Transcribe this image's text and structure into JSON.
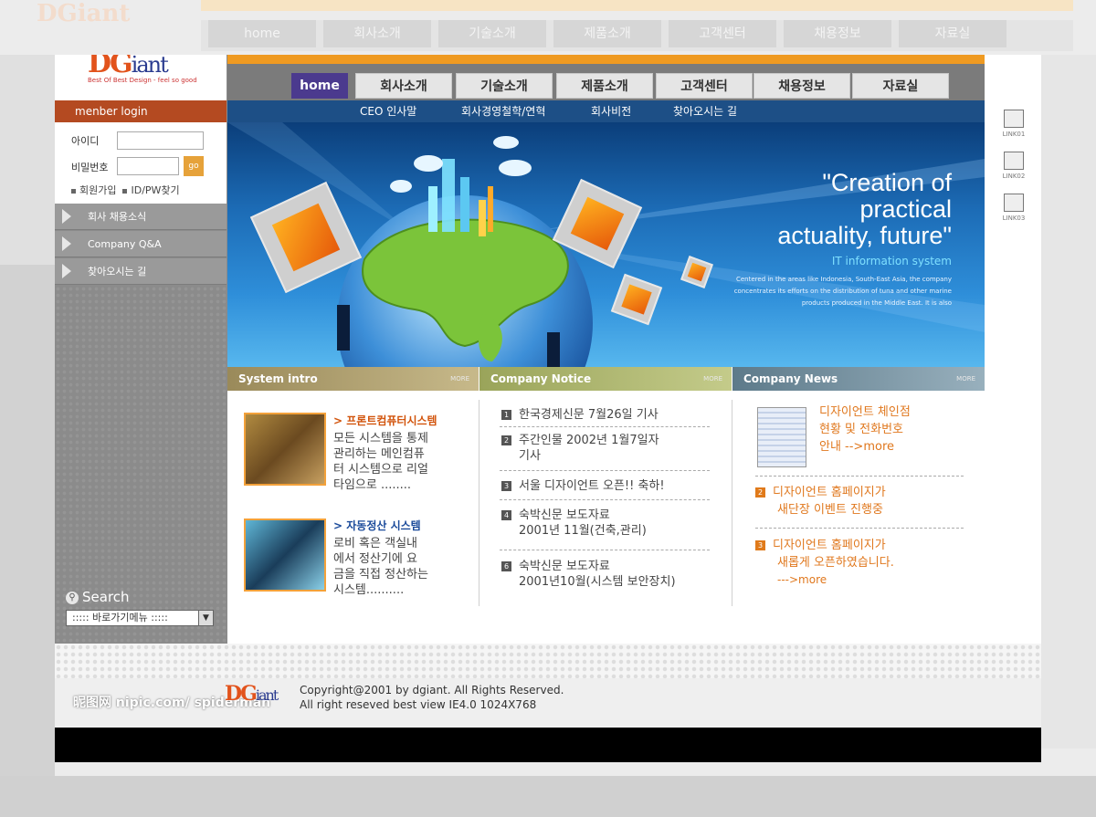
{
  "brand": {
    "logo": "DGiant",
    "tagline": "Best Of Best Design - feel so good"
  },
  "login": {
    "header": "menber login",
    "id_label": "아이디",
    "pw_label": "비밀번호",
    "go_label": "go",
    "join_link": "회원가입",
    "find_link": "ID/PW찾기"
  },
  "side_menu": [
    "회사 채용소식",
    "Company Q&A",
    "찾아오시는 길"
  ],
  "search": {
    "label": "Search",
    "select_value": "::::: 바로가기메뉴 :::::"
  },
  "nav": {
    "home": "home",
    "tabs": [
      "회사소개",
      "기술소개",
      "제품소개",
      "고객센터",
      "채용정보",
      "자료실"
    ]
  },
  "sub_nav": [
    "CEO 인사말",
    "회사경영철학/연혁",
    "회사비전",
    "찾아오시는 길"
  ],
  "hero": {
    "title_line1": "\"Creation of",
    "title_line2": "practical",
    "title_line3": "actuality, future\"",
    "subtitle": "IT information system",
    "desc": "Centered in the areas like Indonesia, South-East Asia, the company concentrates its efforts on the distribution of tuna and other marine products produced in the Middle East. It is also"
  },
  "panels": {
    "system_intro": {
      "title": "System intro",
      "more": "MORE",
      "items": [
        {
          "title": "프론트컴퓨터시스템",
          "text_1": "모든 시스템을 통제",
          "text_2": "관리하는 메인컴퓨",
          "text_3": "터 시스템으로 리얼",
          "text_4": "타임으로 ........"
        },
        {
          "title": "자동정산 시스템",
          "text_1": "로비 혹은 객실내",
          "text_2": "에서 정산기에 요",
          "text_3": "금을 직접 정산하는",
          "text_4": "시스템.........."
        }
      ]
    },
    "company_notice": {
      "title": "Company Notice",
      "more": "MORE",
      "items": [
        {
          "n": "1",
          "line1": "한국경제신문 7월26일 기사",
          "line2": ""
        },
        {
          "n": "2",
          "line1": "주간인물 2002년 1월7일자",
          "line2": "기사"
        },
        {
          "n": "3",
          "line1": "서울 디자이언트 오픈!! 축하!",
          "line2": ""
        },
        {
          "n": "4",
          "line1": "숙박신문 보도자료",
          "line2": "2001년 11월(건축,관리)"
        },
        {
          "n": "6",
          "line1": "숙박신문 보도자료",
          "line2": "2001년10월(시스템 보안장치)"
        }
      ]
    },
    "company_news": {
      "title": "Company News",
      "more": "MORE",
      "first_1": "디자이언트 체인점",
      "first_2": "현황 및 전화번호",
      "first_3": "안내 -->more",
      "items": [
        {
          "n": "2",
          "line1": "디자이언트 홈페이지가",
          "line2": "새단장 이벤트 진행중",
          "line3": ""
        },
        {
          "n": "3",
          "line1": "디자이언트 홈페이지가",
          "line2": "새롭게 오픈하였습니다.",
          "line3": "--->more"
        }
      ]
    }
  },
  "right_links": [
    "LINK01",
    "LINK02",
    "LINK03"
  ],
  "footer": {
    "copyright_1": "Copyright@2001 by dgiant. All Rights Reserved.",
    "copyright_2": "All right reseved best view IE4.0 1024X768",
    "watermark": "昵图网 nipic.com/ spiderman"
  },
  "ghost": {
    "nav": [
      "home",
      "회사소개",
      "기술소개",
      "제품소개",
      "고객센터",
      "채용정보",
      "자료실"
    ]
  },
  "colors": {
    "accent": "#ef9a21",
    "login_header": "#b44a21",
    "nav_home": "#4b3a8e",
    "hero": "#1c6bb5"
  }
}
